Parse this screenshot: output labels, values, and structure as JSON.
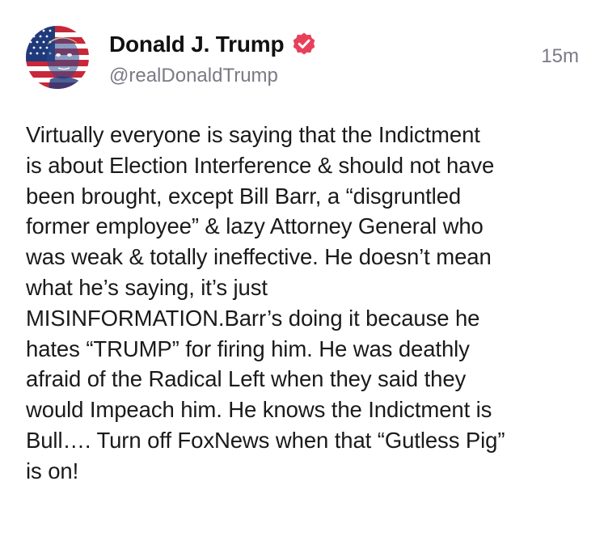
{
  "post": {
    "author": {
      "display_name": "Donald J. Trump",
      "handle": "@realDonaldTrump",
      "verified": true,
      "verified_icon": "verified-badge-icon",
      "avatar_icon": "avatar-flag-portrait"
    },
    "timestamp": "15m",
    "text": "Virtually everyone is saying that the Indictment\nis about Election Interference & should not have\nbeen brought, except Bill Barr, a “disgruntled\nformer employee” & lazy Attorney General who\nwas weak & totally ineffective. He doesn’t mean\nwhat he’s saying, it’s just\nMISINFORMATION.Barr’s doing it because he\nhates “TRUMP” for firing him. He was deathly\nafraid of the Radical Left when they said they\nwould Impeach him. He knows the Indictment is\nBull…. Turn off FoxNews when that “Gutless Pig”\nis on!"
  },
  "colors": {
    "text": "#1a1a1a",
    "muted": "#7a7a85",
    "verified_badge": "#e8405a",
    "background": "#ffffff"
  }
}
